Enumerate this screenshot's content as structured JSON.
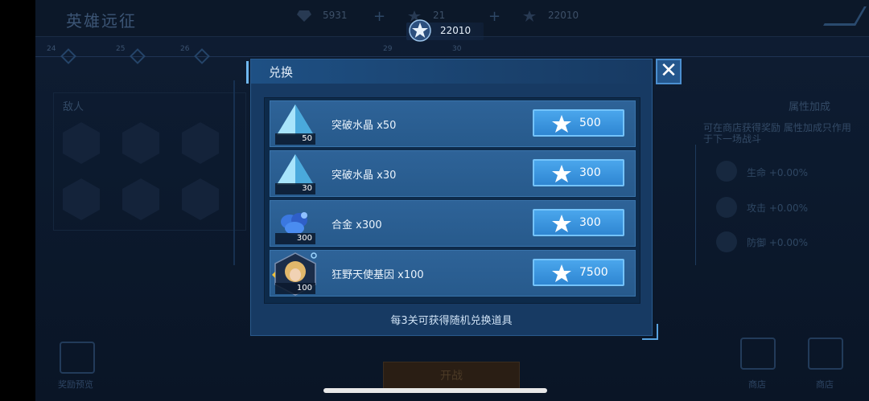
{
  "background": {
    "title": "英雄远征",
    "resources": [
      {
        "icon": "diamond-icon",
        "value": "5931"
      },
      {
        "icon": "star-badge-icon",
        "value": "21"
      },
      {
        "icon": "star-badge-icon",
        "value": "22010"
      }
    ],
    "progress_nodes": [
      "24",
      "25",
      "26",
      "29",
      "30"
    ],
    "enemy_label": "敌人",
    "attr_title": "属性加成",
    "attr_desc": "可在商店获得奖励 属性加成只作用于下一场战斗",
    "stats": [
      "生命 +0.00%",
      "攻击 +0.00%",
      "防御 +0.00%"
    ],
    "go_button": "开战",
    "bottom_left_label": "奖励预览",
    "bottom_right_labels": [
      "商店",
      "商店"
    ]
  },
  "currency": {
    "icon": "star-badge-icon",
    "value": "22010"
  },
  "modal": {
    "title": "兑换",
    "close_icon": "close-icon",
    "footer": "每3关可获得随机兑换道具",
    "items": [
      {
        "name": "突破水晶 x50",
        "qty": "50",
        "price": "500",
        "icon": "crystal-icon"
      },
      {
        "name": "突破水晶 x30",
        "qty": "30",
        "price": "300",
        "icon": "crystal-icon"
      },
      {
        "name": "合金 x300",
        "qty": "300",
        "price": "300",
        "icon": "alloy-icon"
      },
      {
        "name": "狂野天使基因 x100",
        "qty": "100",
        "price": "7500",
        "icon": "hero-portrait-icon"
      }
    ]
  },
  "colors": {
    "modal_bg": "#173a63",
    "row_bg": "#2e6398",
    "button_bg": "#3b97df",
    "accent": "#6fb7ef"
  }
}
